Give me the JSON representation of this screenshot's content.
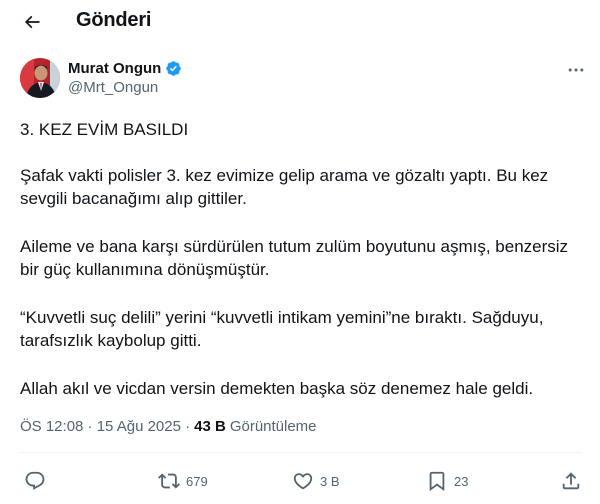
{
  "header": {
    "back_icon": "arrow-left-icon",
    "title": "Gönderi"
  },
  "author": {
    "name": "Murat Ongun",
    "handle": "@Mrt_Ongun",
    "verified": true,
    "verified_color": "#1d9bf0"
  },
  "tweet": {
    "paragraphs": [
      "3. KEZ EVİM BASILDI",
      "Şafak vakti polisler 3. kez evimize gelip arama ve gözaltı yaptı. Bu kez sevgili bacanağımı alıp gittiler.",
      "Aileme ve bana karşı sürdürülen tutum zulüm boyutunu aşmış, benzersiz bir güç kullanımına dönüşmüştür.",
      "“Kuvvetli suç delili” yerini “kuvvetli intikam yemini”ne bıraktı. Sağduyu, tarafsızlık kaybolup gitti.",
      "Allah akıl ve vicdan versin demekten başka söz denemez hale geldi."
    ]
  },
  "meta": {
    "time_date": "ÖS 12:08 · 15 Ağu 2025 ·",
    "views_count": "43 B",
    "views_label": "Görüntüleme"
  },
  "actions": {
    "reply": {
      "icon": "reply-icon",
      "count": ""
    },
    "repost": {
      "icon": "repost-icon",
      "count": "679"
    },
    "like": {
      "icon": "heart-icon",
      "count": "3 B"
    },
    "bookmark": {
      "icon": "bookmark-icon",
      "count": "23"
    },
    "share": {
      "icon": "share-icon",
      "count": ""
    }
  },
  "colors": {
    "text_primary": "#0f1419",
    "text_secondary": "#536471",
    "accent": "#1d9bf0",
    "divider": "#eff3f4"
  }
}
